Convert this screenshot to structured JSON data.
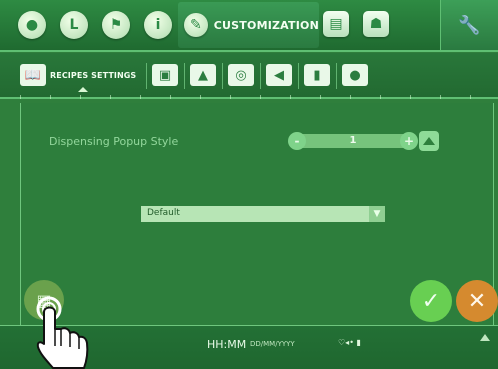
{
  "topbar": {
    "tab_label": "CUSTOMIZATION",
    "buttons": [
      {
        "icon": "drop-icon",
        "glyph": "●"
      },
      {
        "icon": "clock-icon",
        "glyph": "L"
      },
      {
        "icon": "flag-icon",
        "glyph": "⚑"
      },
      {
        "icon": "info-icon",
        "glyph": "i"
      }
    ],
    "right_buttons": [
      {
        "icon": "clipboard-icon",
        "glyph": "▤"
      },
      {
        "icon": "user-icon",
        "glyph": "☗"
      }
    ],
    "wrench_icon": "🔧"
  },
  "subbar": {
    "active_label": "RECIPES SETTINGS",
    "icons": [
      {
        "name": "book-icon",
        "glyph": "📖"
      },
      {
        "name": "book-alt-icon",
        "glyph": "▣"
      },
      {
        "name": "image-icon",
        "glyph": "▲"
      },
      {
        "name": "settings-icon",
        "glyph": "◎"
      },
      {
        "name": "speaker-icon",
        "glyph": "◀"
      },
      {
        "name": "usb-icon",
        "glyph": "▮"
      },
      {
        "name": "palette-icon",
        "glyph": "●"
      }
    ]
  },
  "settings": {
    "dispensing_label": "Dispensing Popup Style",
    "stepper_value": "1",
    "minus_label": "-",
    "plus_label": "+",
    "select_value": "Default",
    "select_arrow": "▼"
  },
  "actions": {
    "copy_icon": "▦",
    "confirm_icon": "✓",
    "cancel_icon": "✕"
  },
  "status": {
    "time": "HH:MM",
    "date": "DD/MM/YYYY",
    "icons_text": "♡◂•  ▮"
  }
}
